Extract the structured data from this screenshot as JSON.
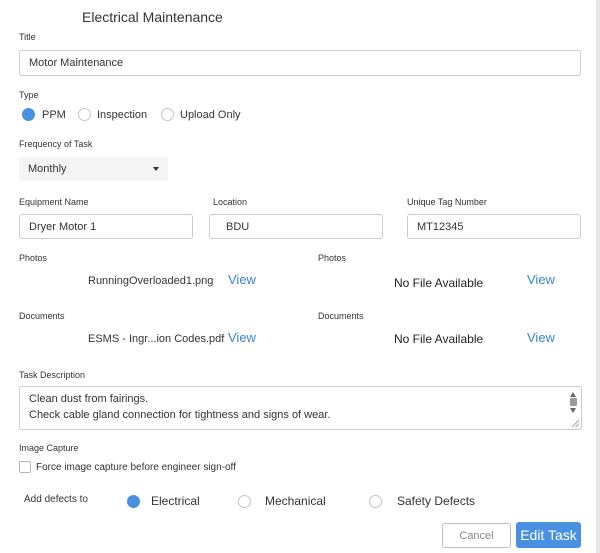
{
  "header": {
    "title": "Electrical Maintenance"
  },
  "title_field": {
    "label": "Title",
    "value": "Motor Maintenance"
  },
  "type": {
    "label": "Type",
    "options": [
      "PPM",
      "Inspection",
      "Upload Only"
    ],
    "selected": "PPM"
  },
  "frequency": {
    "label": "Frequency of Task",
    "value": "Monthly"
  },
  "equipment": {
    "label": "Equipment Name",
    "value": "Dryer Motor 1"
  },
  "location": {
    "label": "Location",
    "value": "BDU"
  },
  "tag": {
    "label": "Unique Tag Number",
    "value": "MT12345"
  },
  "photos_left": {
    "label": "Photos",
    "file": "RunningOverloaded1.png",
    "link": "View"
  },
  "photos_right": {
    "label": "Photos",
    "file": "No File Available",
    "link": "View"
  },
  "documents_left": {
    "label": "Documents",
    "file": "ESMS - Ingr...ion Codes.pdf",
    "link": "View"
  },
  "documents_right": {
    "label": "Documents",
    "file": "No File Available",
    "link": "View"
  },
  "task_description": {
    "label": "Task Description",
    "lines": [
      "Clean dust from fairings.",
      "Check cable gland connection for tightness and signs of wear."
    ]
  },
  "image_capture": {
    "label": "Image Capture",
    "checkbox_label": "Force image capture before engineer sign-off",
    "checked": false
  },
  "defects": {
    "label": "Add defects to",
    "options": [
      "Electrical",
      "Mechanical",
      "Safety Defects"
    ],
    "selected": "Electrical"
  },
  "buttons": {
    "cancel": "Cancel",
    "edit": "Edit Task"
  },
  "colors": {
    "accent": "#4a90e2",
    "link": "#3a84d0"
  }
}
